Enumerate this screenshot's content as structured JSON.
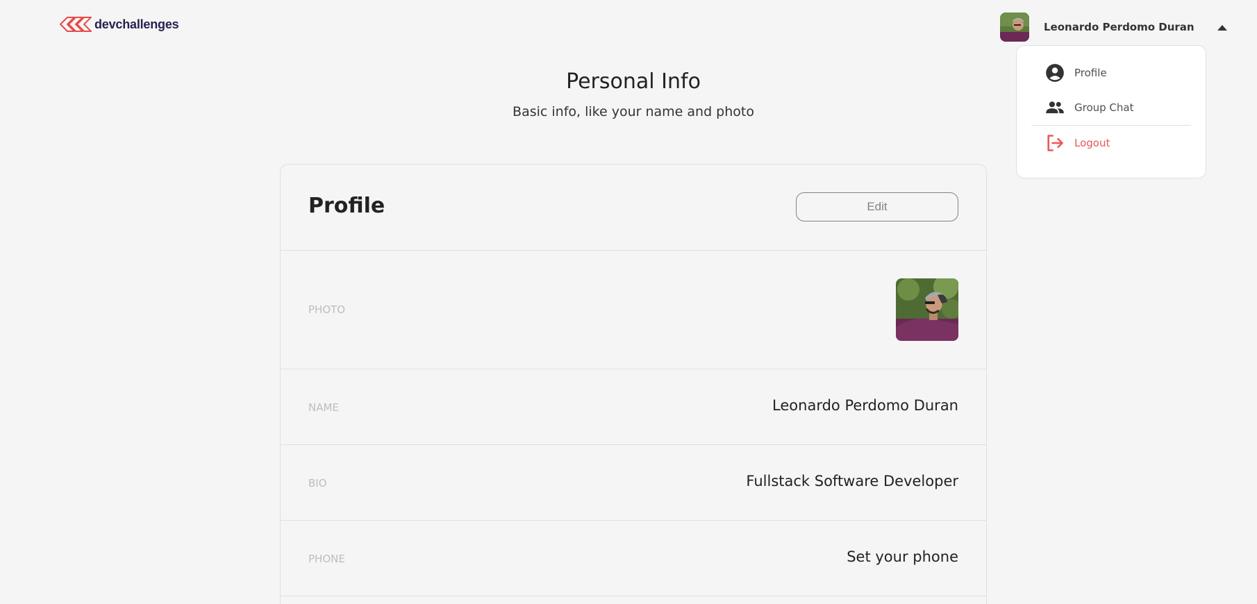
{
  "header": {
    "logo_text": "devchallenges",
    "brand_color": "#e84949",
    "user": {
      "name": "Leonardo Perdomo Duran",
      "menu_open": true
    }
  },
  "dropdown": {
    "items": [
      {
        "label": "Profile",
        "icon": "account-circle-icon"
      },
      {
        "label": "Group Chat",
        "icon": "group-icon"
      },
      {
        "label": "Logout",
        "icon": "logout-icon",
        "color": "#eb5757"
      }
    ]
  },
  "main": {
    "title": "Personal Info",
    "subtitle": "Basic info, like your name and photo"
  },
  "card": {
    "title": "Profile",
    "edit_label": "Edit",
    "rows": [
      {
        "label": "PHOTO",
        "value": ""
      },
      {
        "label": "NAME",
        "value": "Leonardo Perdomo Duran"
      },
      {
        "label": "BIO",
        "value": "Fullstack Software Developer"
      },
      {
        "label": "PHONE",
        "value": "Set your phone"
      }
    ]
  }
}
